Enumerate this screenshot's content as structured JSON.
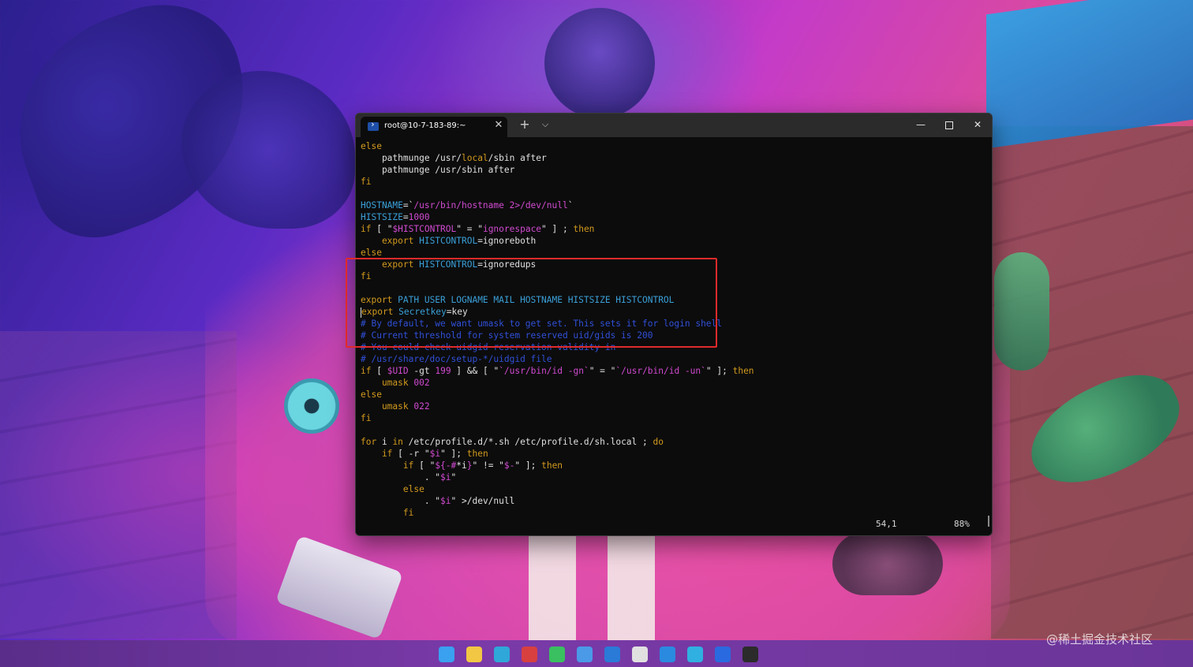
{
  "terminal": {
    "tab_title": "root@10-7-183-89:~",
    "tab_close": "✕",
    "new_tab": "+",
    "dropdown": "⌵",
    "minimize": "—",
    "close": "✕",
    "lines": [
      [
        {
          "t": "else",
          "c": "kw"
        }
      ],
      [
        {
          "t": "    pathmunge /usr/",
          "c": "pl"
        },
        {
          "t": "local",
          "c": "kw"
        },
        {
          "t": "/sbin after",
          "c": "pl"
        }
      ],
      [
        {
          "t": "    pathmunge /usr/sbin after",
          "c": "pl"
        }
      ],
      [
        {
          "t": "fi",
          "c": "kw"
        }
      ],
      [
        {
          "t": "",
          "c": "pl"
        }
      ],
      [
        {
          "t": "HOSTNAME",
          "c": "var"
        },
        {
          "t": "=`",
          "c": "pl"
        },
        {
          "t": "/usr/bin/hostname 2>/dev/null",
          "c": "str"
        },
        {
          "t": "`",
          "c": "pl"
        }
      ],
      [
        {
          "t": "HISTSIZE",
          "c": "var"
        },
        {
          "t": "=",
          "c": "pl"
        },
        {
          "t": "1000",
          "c": "str"
        }
      ],
      [
        {
          "t": "if",
          "c": "kw"
        },
        {
          "t": " [ \"",
          "c": "pl"
        },
        {
          "t": "$HISTCONTROL",
          "c": "str"
        },
        {
          "t": "\" = \"",
          "c": "pl"
        },
        {
          "t": "ignorespace",
          "c": "str"
        },
        {
          "t": "\" ] ; ",
          "c": "pl"
        },
        {
          "t": "then",
          "c": "kw"
        }
      ],
      [
        {
          "t": "    export ",
          "c": "kw"
        },
        {
          "t": "HISTCONTROL",
          "c": "var"
        },
        {
          "t": "=ignoreboth",
          "c": "pl"
        }
      ],
      [
        {
          "t": "else",
          "c": "kw"
        }
      ],
      [
        {
          "t": "    export ",
          "c": "kw"
        },
        {
          "t": "HISTCONTROL",
          "c": "var"
        },
        {
          "t": "=ignoredups",
          "c": "pl"
        }
      ],
      [
        {
          "t": "fi",
          "c": "kw"
        }
      ],
      [
        {
          "t": "",
          "c": "pl"
        }
      ],
      [
        {
          "t": "export ",
          "c": "kw"
        },
        {
          "t": "PATH USER LOGNAME MAIL HOSTNAME HISTSIZE HISTCONTROL",
          "c": "var"
        }
      ],
      [
        {
          "t": "CURSOR",
          "c": "cursor"
        },
        {
          "t": "export ",
          "c": "kw"
        },
        {
          "t": "Secretkey",
          "c": "var"
        },
        {
          "t": "=key",
          "c": "pl"
        }
      ],
      [
        {
          "t": "# By default, we want umask to get set. This sets it for login shell",
          "c": "com"
        }
      ],
      [
        {
          "t": "# Current threshold for system reserved uid/gids is 200",
          "c": "com"
        }
      ],
      [
        {
          "t": "# You could check uidgid reservation validity in",
          "c": "com"
        }
      ],
      [
        {
          "t": "# /usr/share/doc/setup-*/uidgid file",
          "c": "com"
        }
      ],
      [
        {
          "t": "if",
          "c": "kw"
        },
        {
          "t": " [ ",
          "c": "pl"
        },
        {
          "t": "$UID",
          "c": "str"
        },
        {
          "t": " -gt ",
          "c": "pl"
        },
        {
          "t": "199",
          "c": "str"
        },
        {
          "t": " ] && [ \"",
          "c": "pl"
        },
        {
          "t": "`/usr/bin/id -gn`",
          "c": "str"
        },
        {
          "t": "\" = \"",
          "c": "pl"
        },
        {
          "t": "`/usr/bin/id -un`",
          "c": "str"
        },
        {
          "t": "\" ]; ",
          "c": "pl"
        },
        {
          "t": "then",
          "c": "kw"
        }
      ],
      [
        {
          "t": "    umask ",
          "c": "kw"
        },
        {
          "t": "002",
          "c": "str"
        }
      ],
      [
        {
          "t": "else",
          "c": "kw"
        }
      ],
      [
        {
          "t": "    umask ",
          "c": "kw"
        },
        {
          "t": "022",
          "c": "str"
        }
      ],
      [
        {
          "t": "fi",
          "c": "kw"
        }
      ],
      [
        {
          "t": "",
          "c": "pl"
        }
      ],
      [
        {
          "t": "for",
          "c": "kw"
        },
        {
          "t": " i ",
          "c": "pl"
        },
        {
          "t": "in",
          "c": "kw"
        },
        {
          "t": " /etc/profile.d/*.sh /etc/profile.d/sh.local ; ",
          "c": "pl"
        },
        {
          "t": "do",
          "c": "kw"
        }
      ],
      [
        {
          "t": "    if",
          "c": "kw"
        },
        {
          "t": " [ -r \"",
          "c": "pl"
        },
        {
          "t": "$i",
          "c": "str"
        },
        {
          "t": "\" ]; ",
          "c": "pl"
        },
        {
          "t": "then",
          "c": "kw"
        }
      ],
      [
        {
          "t": "        if",
          "c": "kw"
        },
        {
          "t": " [ \"",
          "c": "pl"
        },
        {
          "t": "${-#",
          "c": "str"
        },
        {
          "t": "*i",
          "c": "pl"
        },
        {
          "t": "}",
          "c": "str"
        },
        {
          "t": "\" != \"",
          "c": "pl"
        },
        {
          "t": "$-",
          "c": "str"
        },
        {
          "t": "\" ]; ",
          "c": "pl"
        },
        {
          "t": "then",
          "c": "kw"
        }
      ],
      [
        {
          "t": "            . \"",
          "c": "pl"
        },
        {
          "t": "$i",
          "c": "str"
        },
        {
          "t": "\"",
          "c": "pl"
        }
      ],
      [
        {
          "t": "        else",
          "c": "kw"
        }
      ],
      [
        {
          "t": "            . \"",
          "c": "pl"
        },
        {
          "t": "$i",
          "c": "str"
        },
        {
          "t": "\" >/dev/null",
          "c": "pl"
        }
      ],
      [
        {
          "t": "        fi",
          "c": "kw"
        }
      ]
    ],
    "status_position": "54,1",
    "status_percent": "88%"
  },
  "colors": {
    "keyword": "#d29a1e",
    "variable": "#3aa0d8",
    "string": "#d04ad0",
    "comment": "#3050d8",
    "highlight_box": "#e02a2a"
  },
  "taskbar": {
    "icons": [
      "windows-start-icon",
      "file-explorer-icon",
      "edge-browser-icon",
      "wps-icon",
      "wechat-icon",
      "feishu-icon",
      "maps-icon",
      "chat-icon",
      "vscode-icon",
      "tool-icon",
      "app-star-icon",
      "terminal-icon"
    ]
  },
  "watermark": "@稀土掘金技术社区"
}
